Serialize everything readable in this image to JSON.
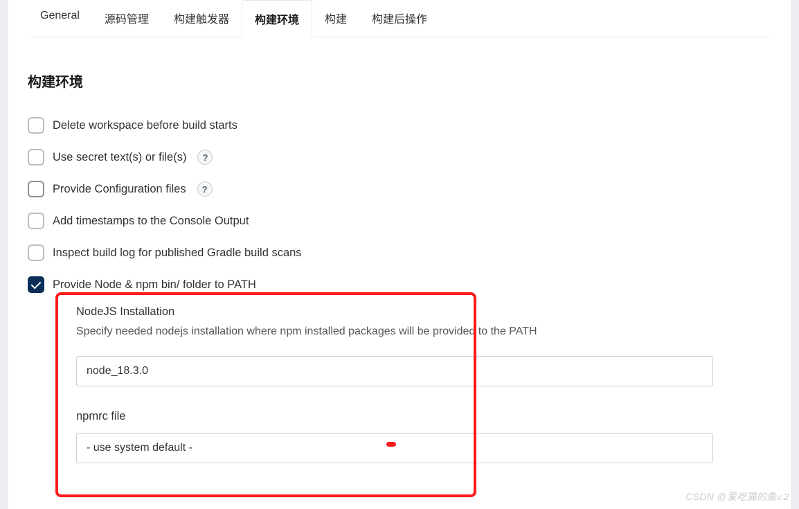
{
  "tabs": {
    "general": "General",
    "scm": "源码管理",
    "triggers": "构建触发器",
    "env": "构建环境",
    "build": "构建",
    "post": "构建后操作"
  },
  "section": {
    "title": "构建环境"
  },
  "options": {
    "deleteWorkspace": "Delete workspace before build starts",
    "useSecret": "Use secret text(s) or file(s)",
    "configFiles": "Provide Configuration files",
    "timestamps": "Add timestamps to the Console Output",
    "gradleScans": "Inspect build log for published Gradle build scans",
    "nodePath": "Provide Node & npm bin/ folder to PATH"
  },
  "help": {
    "glyph": "?"
  },
  "node": {
    "installLabel": "NodeJS Installation",
    "desc": "Specify needed nodejs installation where npm installed packages will be provided to the PATH",
    "installValue": "node_18.3.0",
    "npmrcLabel": "npmrc file",
    "npmrcValue": "- use system default -"
  },
  "watermark": "CSDN @爱吃猫的鱼v.2"
}
